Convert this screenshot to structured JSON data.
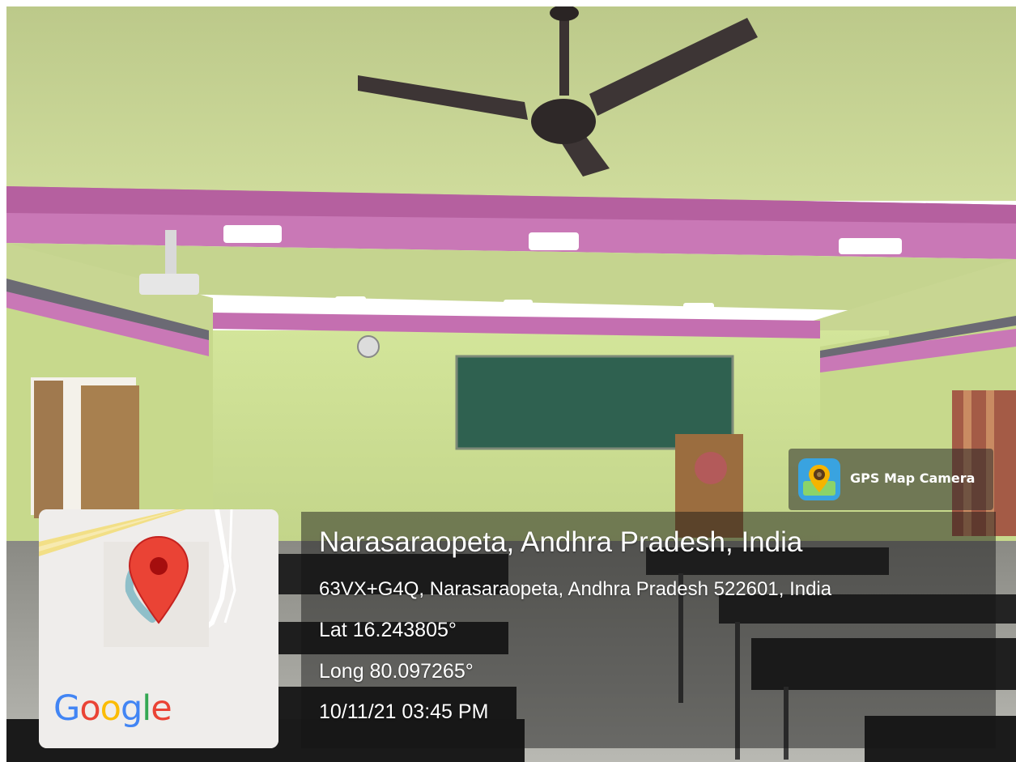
{
  "badge": {
    "app_name": "GPS Map Camera",
    "icon": "gps-map-camera-icon"
  },
  "map": {
    "logo_text": "Google",
    "logo_letters": [
      "G",
      "o",
      "o",
      "g",
      "l",
      "e"
    ],
    "logo_colors": [
      "#4285F4",
      "#EA4335",
      "#FBBC05",
      "#4285F4",
      "#34A853",
      "#EA4335"
    ],
    "pin_color": "#EA4335"
  },
  "location": {
    "title": "Narasaraopeta, Andhra Pradesh, India",
    "address": "63VX+G4Q, Narasaraopeta, Andhra Pradesh 522601, India",
    "lat": "Lat 16.243805°",
    "long": "Long 80.097265°",
    "datetime": "10/11/21 03:45 PM"
  }
}
